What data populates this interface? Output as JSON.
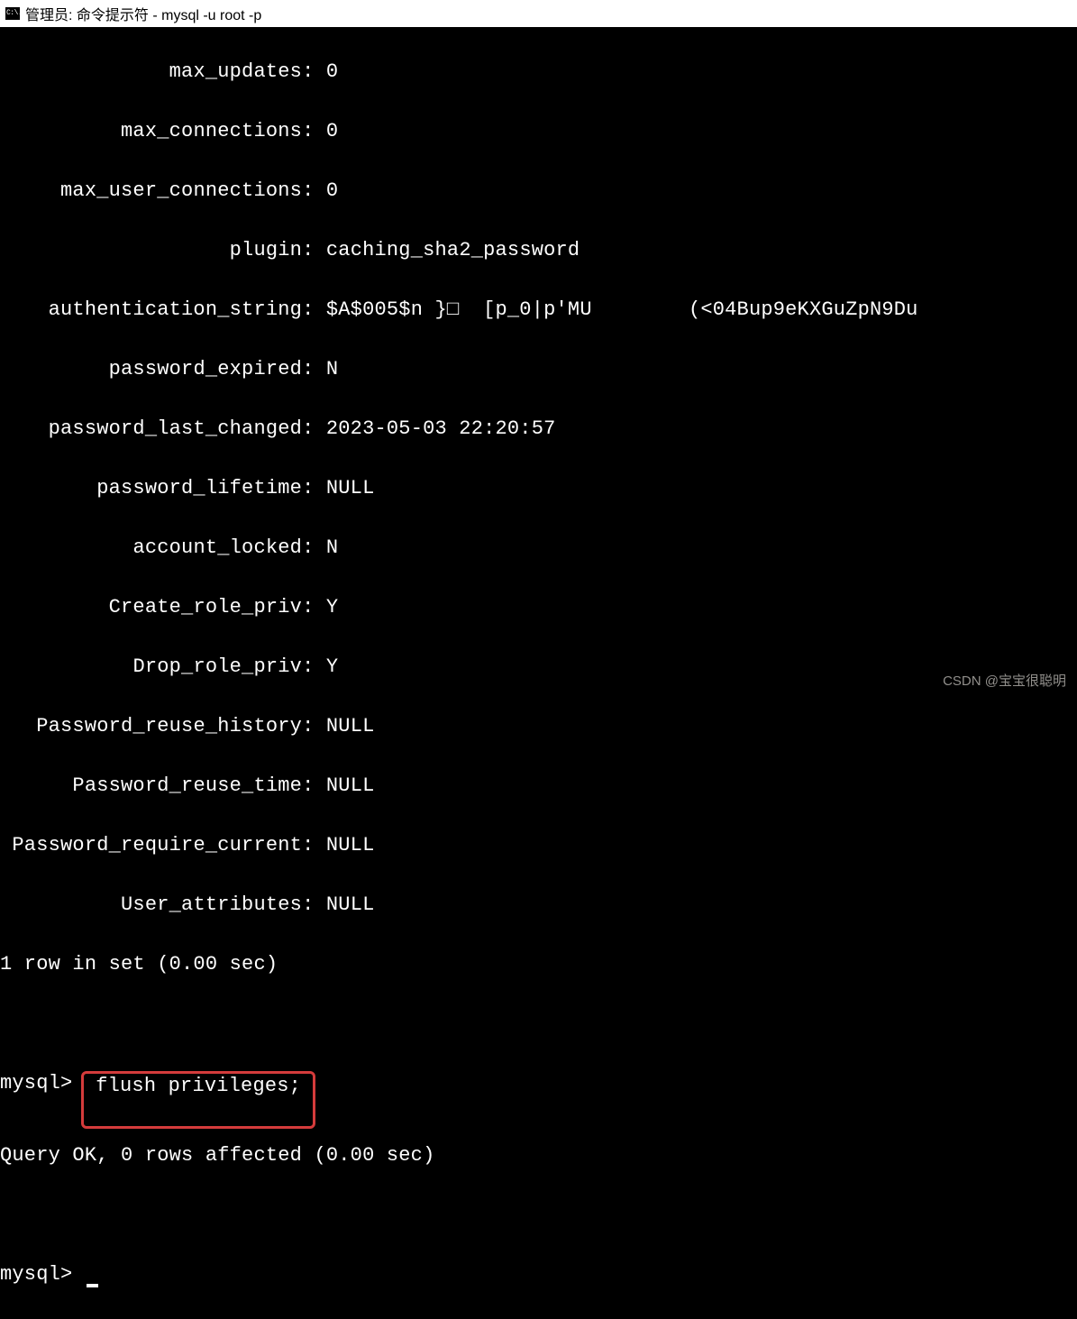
{
  "window": {
    "title": "管理员: 命令提示符 - mysql  -u root -p",
    "icon_text": "C:\\."
  },
  "fields": {
    "max_updates": {
      "label": "max_updates",
      "value": "0"
    },
    "max_connections": {
      "label": "max_connections",
      "value": "0"
    },
    "max_user_connections": {
      "label": "max_user_connections",
      "value": "0"
    },
    "plugin": {
      "label": "plugin",
      "value": "caching_sha2_password"
    },
    "authentication_string": {
      "label": "authentication_string",
      "value": "$A$005$n }□  [p_0|p'MU        (<04Bup9eKXGuZpN9Du"
    },
    "password_expired": {
      "label": "password_expired",
      "value": "N"
    },
    "password_last_changed": {
      "label": "password_last_changed",
      "value": "2023-05-03 22:20:57"
    },
    "password_lifetime": {
      "label": "password_lifetime",
      "value": "NULL"
    },
    "account_locked": {
      "label": "account_locked",
      "value": "N"
    },
    "create_role_priv": {
      "label": "Create_role_priv",
      "value": "Y"
    },
    "drop_role_priv": {
      "label": "Drop_role_priv",
      "value": "Y"
    },
    "password_reuse_history": {
      "label": "Password_reuse_history",
      "value": "NULL"
    },
    "password_reuse_time": {
      "label": "Password_reuse_time",
      "value": "NULL"
    },
    "password_require_current": {
      "label": "Password_require_current",
      "value": "NULL"
    },
    "user_attributes": {
      "label": "User_attributes",
      "value": "NULL"
    }
  },
  "summary": "1 row in set (0.00 sec)",
  "prompt1": "mysql> ",
  "command": " flush privileges; ",
  "result": "Query OK, 0 rows affected (0.00 sec)",
  "prompt2": "mysql> ",
  "watermark": "CSDN @宝宝很聪明"
}
